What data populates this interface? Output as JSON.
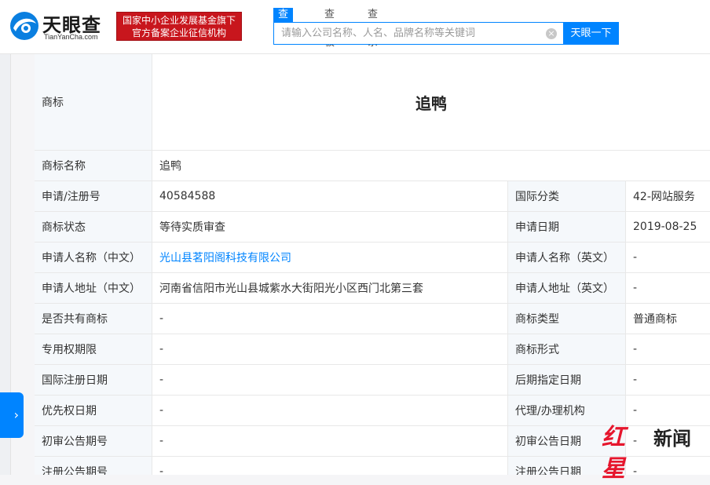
{
  "header": {
    "logo_text": "天眼查",
    "logo_sub": "TianYanCha.com",
    "banner_line1": "国家中小企业发展基金旗下",
    "banner_line2": "官方备案企业征信机构",
    "tabs": [
      {
        "label": "查公司",
        "active": true
      },
      {
        "label": "查老板",
        "active": false
      },
      {
        "label": "查关系",
        "active": false
      }
    ],
    "search_placeholder": "请输入公司名称、人名、品牌名称等关键词",
    "search_button": "天眼一下"
  },
  "trademark": {
    "label": "商标",
    "image_text": "追鸭"
  },
  "rows": [
    {
      "l1": "商标名称",
      "v1": "追鸭"
    },
    {
      "l1": "申请/注册号",
      "v1": "40584588",
      "l2": "国际分类",
      "v2": "42-网站服务"
    },
    {
      "l1": "商标状态",
      "v1": "等待实质审查",
      "l2": "申请日期",
      "v2": "2019-08-25"
    },
    {
      "l1": "申请人名称（中文）",
      "v1": "光山县茗阳阁科技有限公司",
      "l2": "申请人名称（英文）",
      "v2": "-"
    },
    {
      "l1": "申请人地址（中文）",
      "v1": "河南省信阳市光山县城紫水大街阳光小区西门北第三套",
      "l2": "申请人地址（英文）",
      "v2": "-"
    },
    {
      "l1": "是否共有商标",
      "v1": "-",
      "l2": "商标类型",
      "v2": "普通商标"
    },
    {
      "l1": "专用权期限",
      "v1": "-",
      "l2": "商标形式",
      "v2": "-"
    },
    {
      "l1": "国际注册日期",
      "v1": "-",
      "l2": "后期指定日期",
      "v2": "-"
    },
    {
      "l1": "优先权日期",
      "v1": "-",
      "l2": "代理/办理机构",
      "v2": "-"
    },
    {
      "l1": "初审公告期号",
      "v1": "-",
      "l2": "初审公告日期",
      "v2": "-"
    },
    {
      "l1": "注册公告期号",
      "v1": "-",
      "l2": "注册公告日期",
      "v2": "-"
    }
  ],
  "side_tab": {
    "arrow": "›"
  },
  "watermark": {
    "part1": "红星",
    "part2": "新闻"
  }
}
